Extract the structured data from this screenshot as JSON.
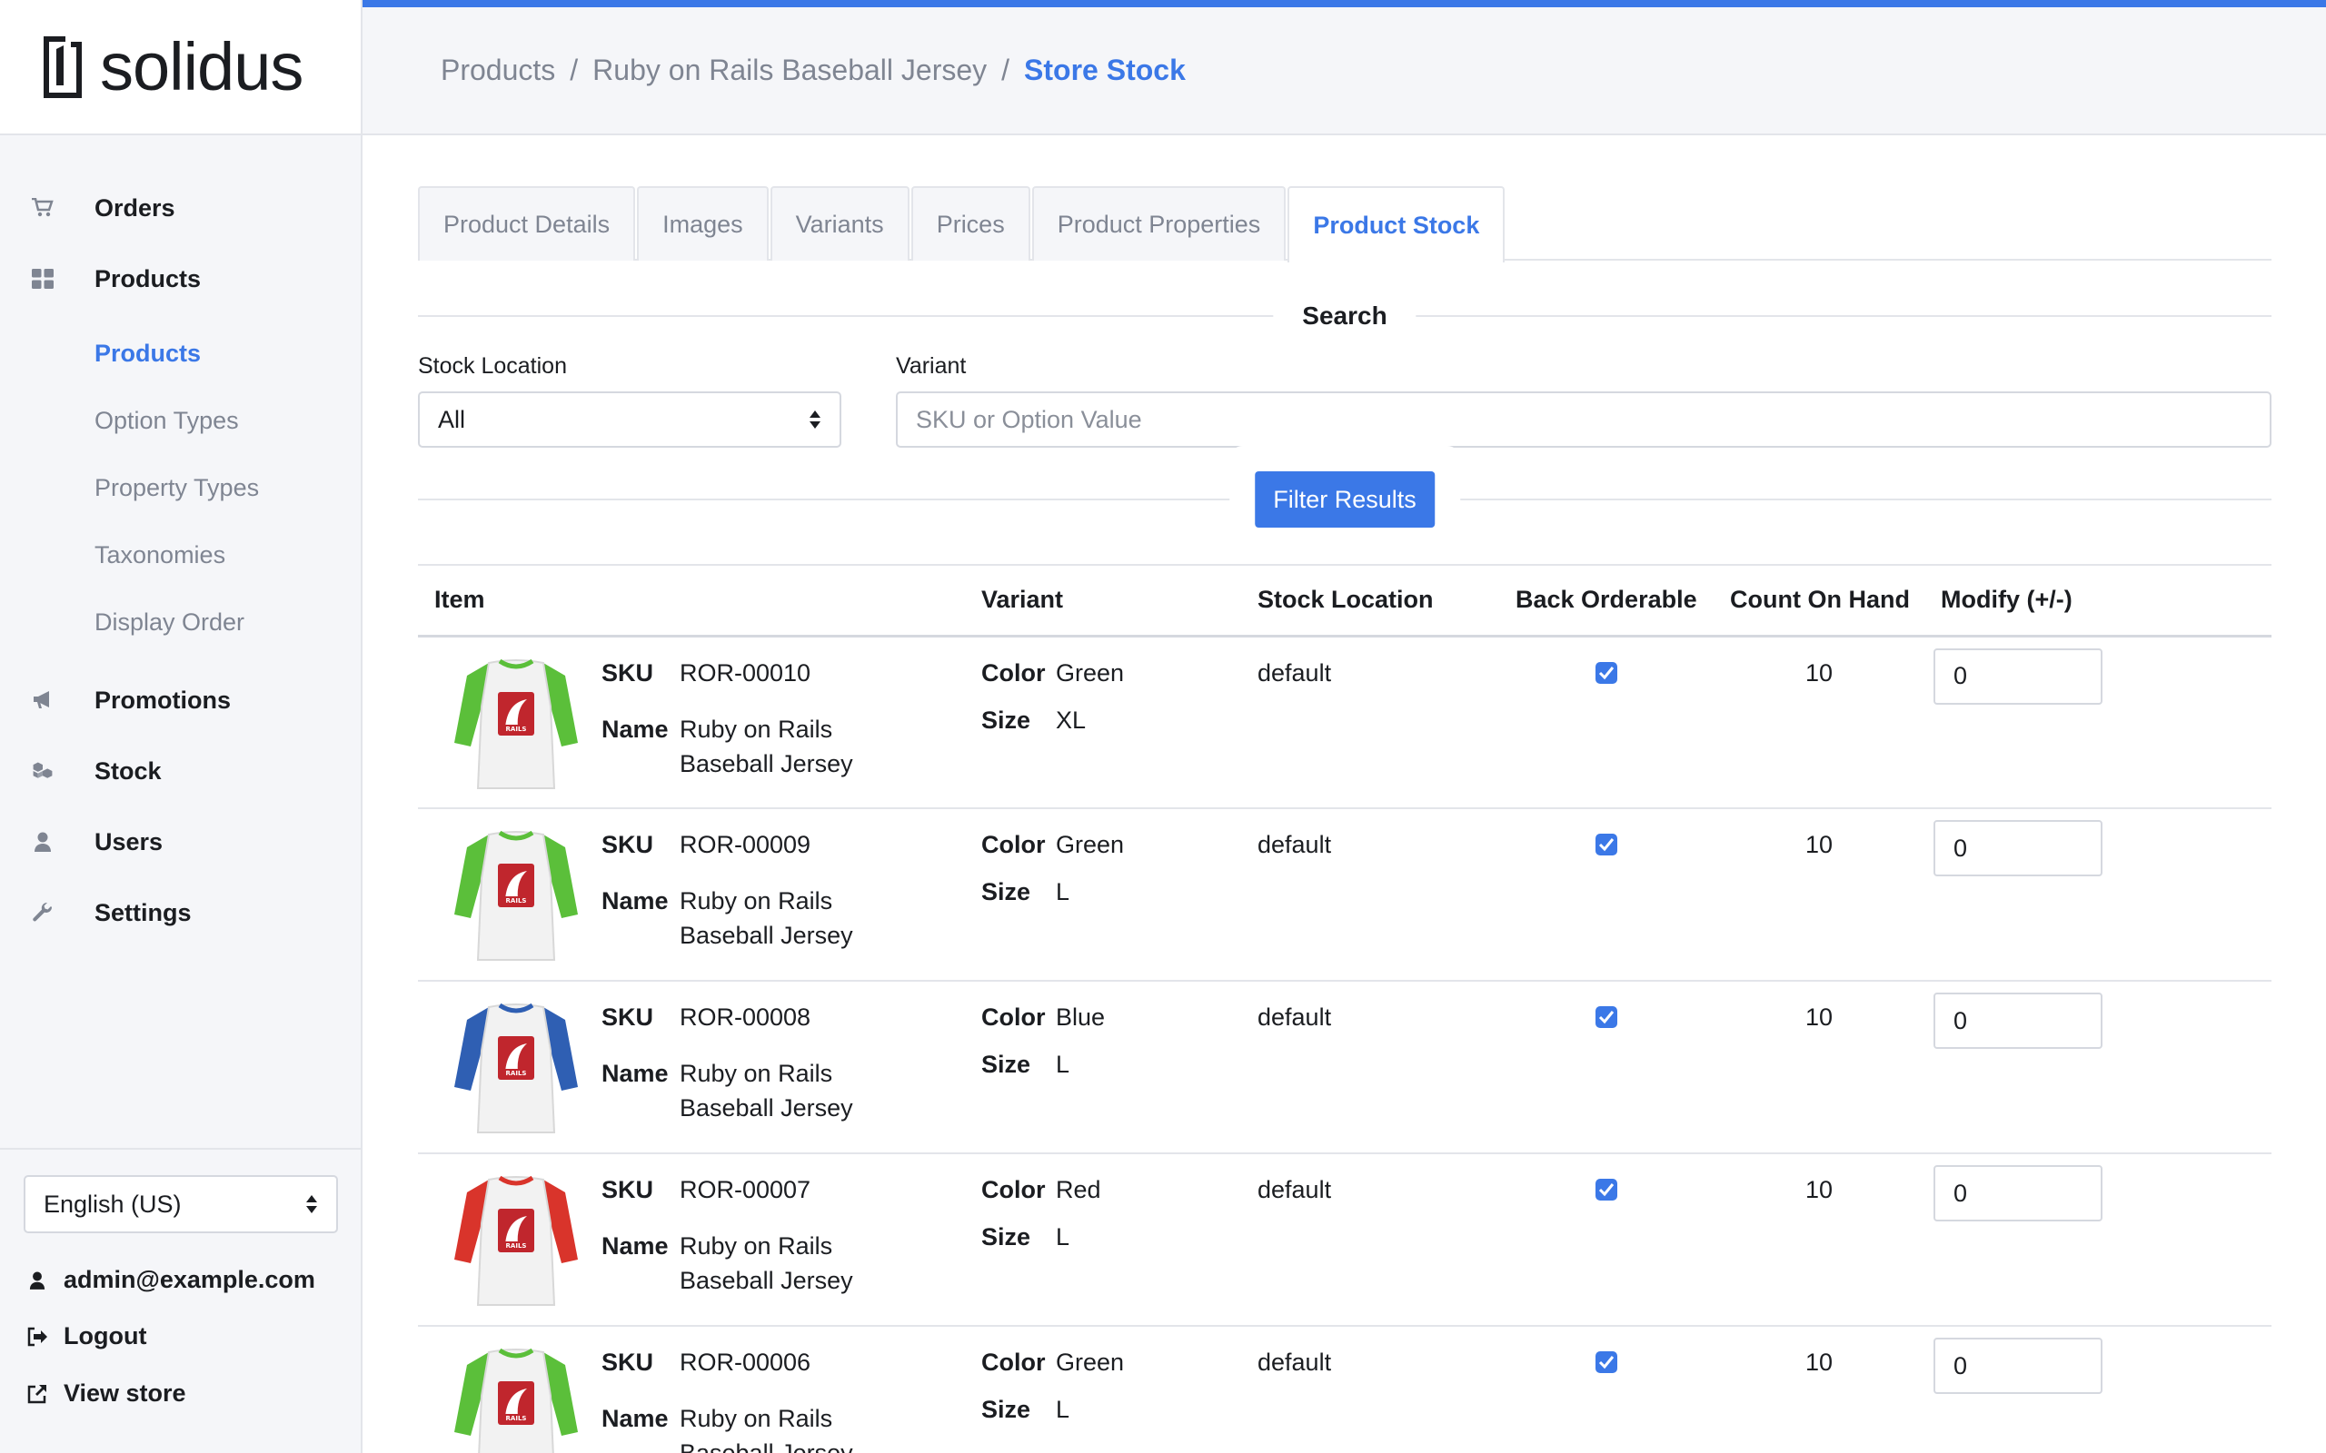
{
  "app": {
    "logo_text": "solidus",
    "accent_color": "#3b78e7"
  },
  "breadcrumb": {
    "items": [
      "Products",
      "Ruby on Rails Baseball Jersey"
    ],
    "current": "Store Stock",
    "separator": "/"
  },
  "sidebar": {
    "nav": [
      {
        "label": "Orders",
        "icon": "cart-icon"
      },
      {
        "label": "Products",
        "icon": "grid-icon"
      }
    ],
    "subnav": [
      {
        "label": "Products",
        "active": true
      },
      {
        "label": "Option Types"
      },
      {
        "label": "Property Types"
      },
      {
        "label": "Taxonomies"
      },
      {
        "label": "Display Order"
      }
    ],
    "nav_after": [
      {
        "label": "Promotions",
        "icon": "bullhorn-icon"
      },
      {
        "label": "Stock",
        "icon": "cubes-icon"
      },
      {
        "label": "Users",
        "icon": "user-icon"
      },
      {
        "label": "Settings",
        "icon": "wrench-icon"
      }
    ],
    "footer": {
      "locale": "English (US)",
      "user_email": "admin@example.com",
      "logout": "Logout",
      "view_store": "View store"
    }
  },
  "tabs": [
    {
      "label": "Product Details"
    },
    {
      "label": "Images"
    },
    {
      "label": "Variants"
    },
    {
      "label": "Prices"
    },
    {
      "label": "Product Properties"
    },
    {
      "label": "Product Stock",
      "active": true
    }
  ],
  "search": {
    "title": "Search",
    "stock_location_label": "Stock Location",
    "stock_location_value": "All",
    "variant_label": "Variant",
    "variant_placeholder": "SKU or Option Value",
    "filter_button": "Filter Results"
  },
  "table": {
    "headers": [
      "Item",
      "Variant",
      "Stock Location",
      "Back Orderable",
      "Count On Hand",
      "Modify (+/-)"
    ],
    "sku_label": "SKU",
    "name_label": "Name",
    "color_label": "Color",
    "size_label": "Size",
    "rows": [
      {
        "sku": "ROR-00010",
        "name_line1": "Ruby on Rails",
        "name_line2": "Baseball Jersey",
        "color": "Green",
        "size": "XL",
        "location": "default",
        "backorderable": true,
        "count": "10",
        "modify": "0",
        "sleeve_color": "#5bbf3a"
      },
      {
        "sku": "ROR-00009",
        "name_line1": "Ruby on Rails",
        "name_line2": "Baseball Jersey",
        "color": "Green",
        "size": "L",
        "location": "default",
        "backorderable": true,
        "count": "10",
        "modify": "0",
        "sleeve_color": "#5bbf3a"
      },
      {
        "sku": "ROR-00008",
        "name_line1": "Ruby on Rails",
        "name_line2": "Baseball Jersey",
        "color": "Blue",
        "size": "L",
        "location": "default",
        "backorderable": true,
        "count": "10",
        "modify": "0",
        "sleeve_color": "#2f5fb3"
      },
      {
        "sku": "ROR-00007",
        "name_line1": "Ruby on Rails",
        "name_line2": "Baseball Jersey",
        "color": "Red",
        "size": "L",
        "location": "default",
        "backorderable": true,
        "count": "10",
        "modify": "0",
        "sleeve_color": "#d9342b"
      },
      {
        "sku": "ROR-00006",
        "name_line1": "Ruby on Rails",
        "name_line2": "Baseball Jersey",
        "color": "Green",
        "size": "L",
        "location": "default",
        "backorderable": true,
        "count": "10",
        "modify": "0",
        "sleeve_color": "#5bbf3a"
      }
    ]
  }
}
